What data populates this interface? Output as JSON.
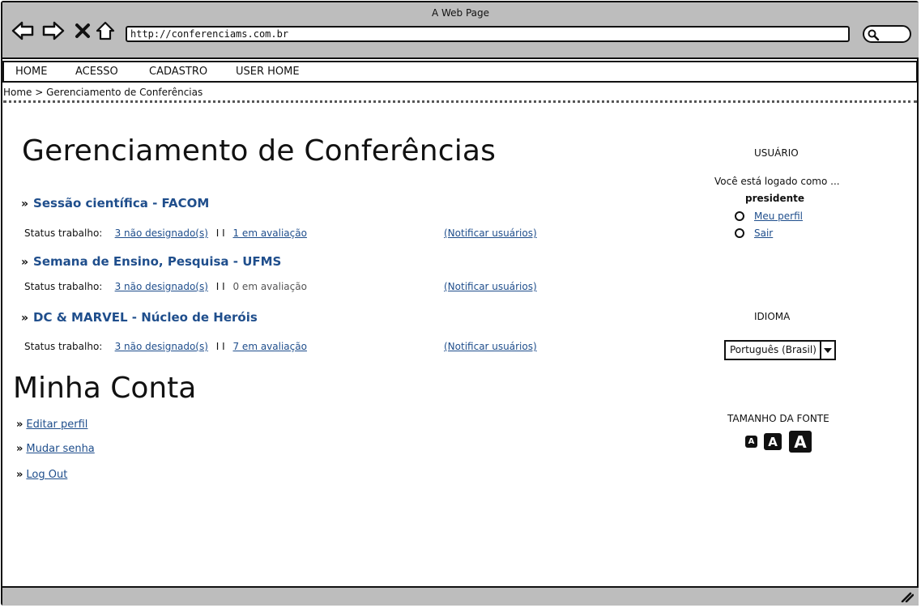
{
  "window": {
    "title": "A Web Page",
    "url": "http://conferenciams.com.br"
  },
  "menu": [
    "HOME",
    "ACESSO",
    "CADASTRO",
    "USER HOME"
  ],
  "breadcrumb": "Home > Gerenciamento de Conferências",
  "main": {
    "title": "Gerenciamento de Conferências",
    "status_label": "Status trabalho:",
    "separator": "I I",
    "notify_label": "(Notificar usuários)",
    "conferences": [
      {
        "name": "Sessão científica - FACOM",
        "unassigned": "3 não designado(s)",
        "in_review": "1 em avaliação"
      },
      {
        "name": "Semana de Ensino, Pesquisa - UFMS",
        "unassigned": "3 não designado(s)",
        "in_review": "0 em avaliação"
      },
      {
        "name": "DC & MARVEL - Núcleo de Heróis",
        "unassigned": "3 não designado(s)",
        "in_review": "7 em avaliação"
      }
    ]
  },
  "account": {
    "title": "Minha Conta",
    "links": [
      "Editar perfil",
      "Mudar senha",
      "Log Out"
    ]
  },
  "sidebar": {
    "user_heading": "USUÁRIO",
    "logged_text": "Você está logado  como ...",
    "role": "presidente",
    "user_links": [
      "Meu perfil",
      "Sair"
    ],
    "language_heading": "IDIOMA",
    "language_value": "Português (Brasil)",
    "font_heading": "TAMANHO DA FONTE",
    "font_sizes": [
      "A",
      "A",
      "A"
    ]
  },
  "colors": {
    "link": "#1f4e8c",
    "chrome": "#bdbdbd"
  }
}
